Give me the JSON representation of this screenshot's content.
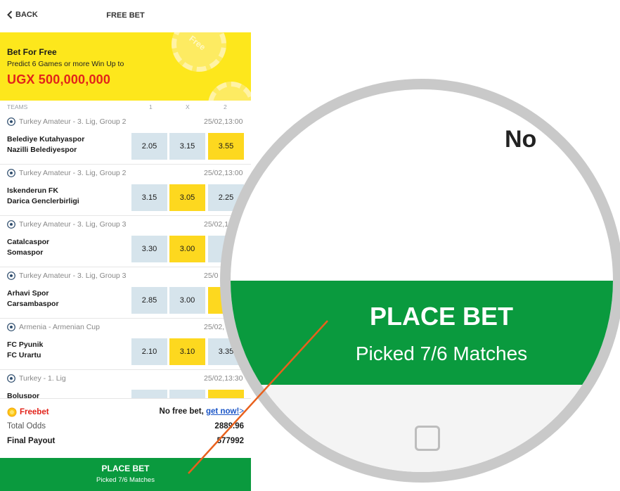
{
  "header": {
    "back_label": "BACK",
    "title": "FREE BET"
  },
  "banner": {
    "heading": "Bet For Free",
    "subtitle": "Predict 6 Games or more Win Up to",
    "amount": "UGX 500,000,000",
    "chip_label": "Free"
  },
  "columns": {
    "teams": "TEAMS",
    "c1": "1",
    "cx": "X",
    "c2": "2"
  },
  "matches": [
    {
      "league": "Turkey Amateur - 3. Lig, Group 2",
      "date": "25/02,13:00",
      "home": "Belediye Kutahyaspor",
      "away": "Nazilli Belediyespor",
      "odds": [
        "2.05",
        "3.15",
        "3.55"
      ],
      "selected": 2
    },
    {
      "league": "Turkey Amateur - 3. Lig, Group 2",
      "date": "25/02,13:00",
      "home": "Iskenderun FK",
      "away": "Darica Genclerbirligi",
      "odds": [
        "3.15",
        "3.05",
        "2.25"
      ],
      "selected": 1
    },
    {
      "league": "Turkey Amateur - 3. Lig, Group 3",
      "date": "25/02,1",
      "home": "Catalcaspor",
      "away": "Somaspor",
      "odds": [
        "3.30",
        "3.00",
        "2"
      ],
      "selected": 1
    },
    {
      "league": "Turkey Amateur - 3. Lig, Group 3",
      "date": "25/0",
      "home": "Arhavi Spor",
      "away": "Carsambaspor",
      "odds": [
        "2.85",
        "3.00",
        "2"
      ],
      "selected": 2
    },
    {
      "league": "Armenia - Armenian Cup",
      "date": "25/02,",
      "home": "FC Pyunik",
      "away": "FC Urartu",
      "odds": [
        "2.10",
        "3.10",
        "3.35"
      ],
      "selected": 1
    },
    {
      "league": "Turkey - 1. Lig",
      "date": "25/02,13:30",
      "home": "Boluspor",
      "away": "",
      "odds": [
        "",
        "",
        ""
      ],
      "selected": 2
    }
  ],
  "summary": {
    "freebet_label": "Freebet",
    "freebet_value": "No free bet,",
    "freebet_link": "get now!",
    "freebet_link_tail": ">",
    "total_odds_label": "Total Odds",
    "total_odds_value": "2889.96",
    "final_payout_label": "Final Payout",
    "final_payout_value": "577992"
  },
  "place_bet": {
    "label": "PLACE BET",
    "sub": "Picked 7/6 Matches"
  },
  "magnifier": {
    "top_text": "No",
    "label": "PLACE BET",
    "sub": "Picked 7/6 Matches"
  },
  "colors": {
    "brand_yellow": "#fde71c",
    "brand_green": "#0a9a3e",
    "accent_red": "#e2231a",
    "pointer": "#e8601c"
  }
}
